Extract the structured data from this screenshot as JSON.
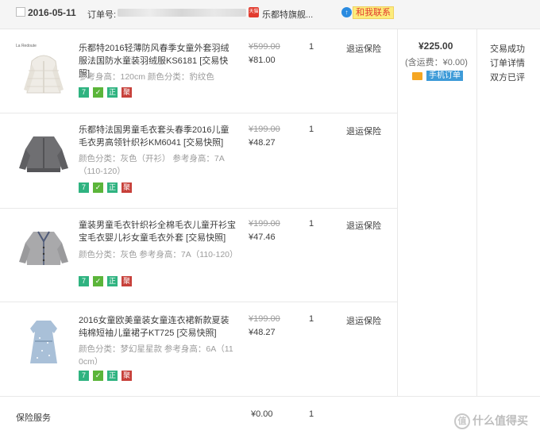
{
  "header": {
    "date": "2016-05-11",
    "order_label": "订单号:",
    "shop_icon_text": "天猫",
    "shop_name": "乐都特旗舰...",
    "contact_icon_text": "↑",
    "contact_label": "和我联系"
  },
  "items": [
    {
      "title": "乐都特2016轻薄防风春季女童外套羽绒服法国防水童装羽绒服KS6181 [交易快照]",
      "attrs": "参考身高：120cm   颜色分类：豹纹色",
      "orig_price": "¥599.00",
      "price": "¥81.00",
      "qty": "1",
      "service": "退运保险",
      "thumb_label": "La Redoute",
      "thumb_color": "#efece6"
    },
    {
      "title": "乐都特法国男童毛衣套头春季2016儿童毛衣男高领针织衫KM6041 [交易快照]",
      "attrs": "颜色分类：灰色（开衫）   参考身高：7A（110-120）",
      "orig_price": "¥199.00",
      "price": "¥48.27",
      "qty": "1",
      "service": "退运保险",
      "thumb_label": "",
      "thumb_color": "#6f6f72"
    },
    {
      "title": "童装男童毛衣针织衫全棉毛衣儿童开衫宝宝毛衣婴儿衫女童毛衣外套 [交易快照]",
      "attrs": "颜色分类：灰色   参考身高：7A（110-120）",
      "orig_price": "¥199.00",
      "price": "¥47.46",
      "qty": "1",
      "service": "退运保险",
      "thumb_label": "",
      "thumb_color": "#a9a9ab"
    },
    {
      "title": "2016女童欧美童装女童连衣裙新款夏装纯棉短袖儿童裙子KT725 [交易快照]",
      "attrs": "颜色分类：梦幻星星款   参考身高：6A（110cm）",
      "orig_price": "¥199.00",
      "price": "¥48.27",
      "qty": "1",
      "service": "退运保险",
      "thumb_label": "",
      "thumb_color": "#a9c0d8"
    }
  ],
  "badges": [
    "7",
    "✓",
    "正",
    "聚"
  ],
  "summary": {
    "total": "¥225.00",
    "shipping": "(含运费：¥0.00)",
    "mobile_label": "手机订单"
  },
  "status": {
    "line1": "交易成功",
    "line2": "订单详情",
    "line3": "双方已评"
  },
  "insurance": {
    "label": "保险服务",
    "price": "¥0.00",
    "qty": "1"
  },
  "watermark": {
    "icon_text": "值",
    "text": "什么值得买"
  }
}
